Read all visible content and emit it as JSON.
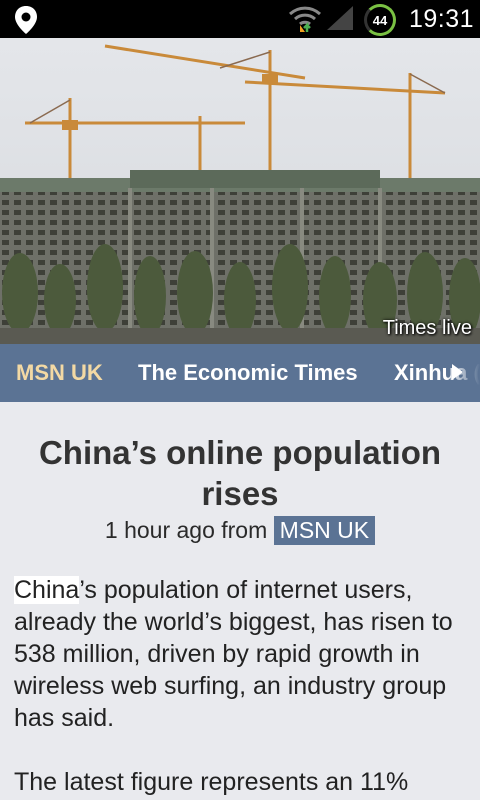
{
  "status_bar": {
    "battery": "44",
    "time": "19:31"
  },
  "hero": {
    "caption": "Times live"
  },
  "sources": {
    "tabs": [
      "MSN UK",
      "The Economic Times",
      "Xinhua ("
    ],
    "active": "MSN UK"
  },
  "article": {
    "headline": "China’s online population rises",
    "meta_prefix": "1 hour ago from",
    "meta_source": "MSN UK",
    "p1_highlight": "China",
    "p1_rest": "’s population of internet users, already the world’s biggest, has risen to 538 million, driven by rapid growth in wireless web surfing, an industry group has said.",
    "p2": "The latest figure represents an 11%"
  },
  "colors": {
    "tab_bar": "#5b7394",
    "active_tab": "#f3d9a4",
    "background": "#e9eaee",
    "battery_ring": "#7ac143"
  },
  "icons": [
    "location-pin-icon",
    "wifi-icon",
    "cell-signal-icon",
    "battery-icon",
    "scroll-right-arrow-icon"
  ]
}
